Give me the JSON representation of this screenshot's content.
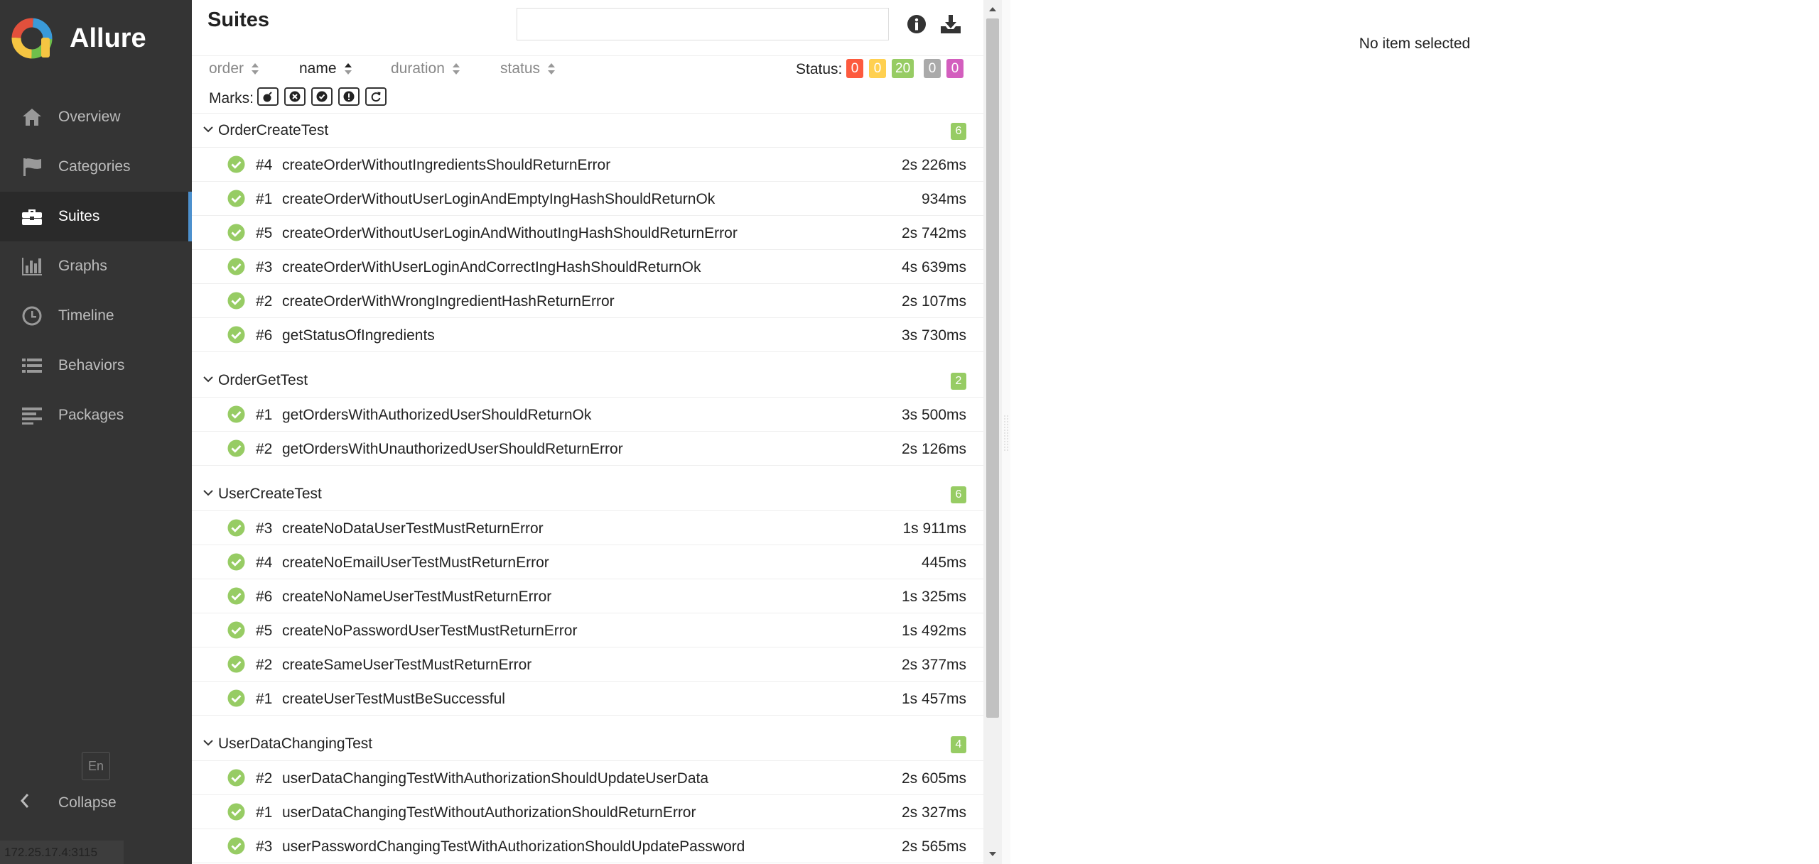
{
  "brand": {
    "name": "Allure"
  },
  "nav": [
    {
      "label": "Overview",
      "icon": "home-icon",
      "active": false
    },
    {
      "label": "Categories",
      "icon": "flag-icon",
      "active": false
    },
    {
      "label": "Suites",
      "icon": "briefcase-icon",
      "active": true
    },
    {
      "label": "Graphs",
      "icon": "bar-chart-icon",
      "active": false
    },
    {
      "label": "Timeline",
      "icon": "clock-icon",
      "active": false
    },
    {
      "label": "Behaviors",
      "icon": "list-icon",
      "active": false
    },
    {
      "label": "Packages",
      "icon": "align-left-icon",
      "active": false
    }
  ],
  "sidebar_footer": {
    "language": "En",
    "collapse_label": "Collapse",
    "status_url": "172.25.17.4:3115"
  },
  "main": {
    "title": "Suites",
    "search": {
      "value": "",
      "placeholder": ""
    },
    "sort": {
      "order": "order",
      "name": "name",
      "duration": "duration",
      "status": "status"
    },
    "status_label": "Status:",
    "status_counts": [
      {
        "key": "failed",
        "value": "0",
        "color": "#fd5a3e"
      },
      {
        "key": "broken",
        "value": "0",
        "color": "#ffd050"
      },
      {
        "key": "passed",
        "value": "20",
        "color": "#97cc64"
      },
      {
        "key": "skipped",
        "value": "0",
        "color": "#aaaaaa"
      },
      {
        "key": "unknown",
        "value": "0",
        "color": "#d35ebe"
      }
    ],
    "marks_label": "Marks:",
    "groups": [
      {
        "name": "OrderCreateTest",
        "count": "6",
        "tests": [
          {
            "num": "#4",
            "name": "createOrderWithoutIngredientsShouldReturnError",
            "duration": "2s 226ms"
          },
          {
            "num": "#1",
            "name": "createOrderWithoutUserLoginAndEmptyIngHashShouldReturnOk",
            "duration": "934ms"
          },
          {
            "num": "#5",
            "name": "createOrderWithoutUserLoginAndWithoutIngHashShouldReturnError",
            "duration": "2s 742ms"
          },
          {
            "num": "#3",
            "name": "createOrderWithUserLoginAndCorrectIngHashShouldReturnOk",
            "duration": "4s 639ms"
          },
          {
            "num": "#2",
            "name": "createOrderWithWrongIngredientHashReturnError",
            "duration": "2s 107ms"
          },
          {
            "num": "#6",
            "name": "getStatusOfIngredients",
            "duration": "3s 730ms"
          }
        ]
      },
      {
        "name": "OrderGetTest",
        "count": "2",
        "tests": [
          {
            "num": "#1",
            "name": "getOrdersWithAuthorizedUserShouldReturnOk",
            "duration": "3s 500ms"
          },
          {
            "num": "#2",
            "name": "getOrdersWithUnauthorizedUserShouldReturnError",
            "duration": "2s 126ms"
          }
        ]
      },
      {
        "name": "UserCreateTest",
        "count": "6",
        "tests": [
          {
            "num": "#3",
            "name": "createNoDataUserTestMustReturnError",
            "duration": "1s 911ms"
          },
          {
            "num": "#4",
            "name": "createNoEmailUserTestMustReturnError",
            "duration": "445ms"
          },
          {
            "num": "#6",
            "name": "createNoNameUserTestMustReturnError",
            "duration": "1s 325ms"
          },
          {
            "num": "#5",
            "name": "createNoPasswordUserTestMustReturnError",
            "duration": "1s 492ms"
          },
          {
            "num": "#2",
            "name": "createSameUserTestMustReturnError",
            "duration": "2s 377ms"
          },
          {
            "num": "#1",
            "name": "createUserTestMustBeSuccessful",
            "duration": "1s 457ms"
          }
        ]
      },
      {
        "name": "UserDataChangingTest",
        "count": "4",
        "tests": [
          {
            "num": "#2",
            "name": "userDataChangingTestWithAuthorizationShouldUpdateUserData",
            "duration": "2s 605ms"
          },
          {
            "num": "#1",
            "name": "userDataChangingTestWithoutAuthorizationShouldReturnError",
            "duration": "2s 327ms"
          },
          {
            "num": "#3",
            "name": "userPasswordChangingTestWithAuthorizationShouldUpdatePassword",
            "duration": "2s 565ms"
          }
        ]
      }
    ]
  },
  "detail": {
    "empty_text": "No item selected"
  }
}
